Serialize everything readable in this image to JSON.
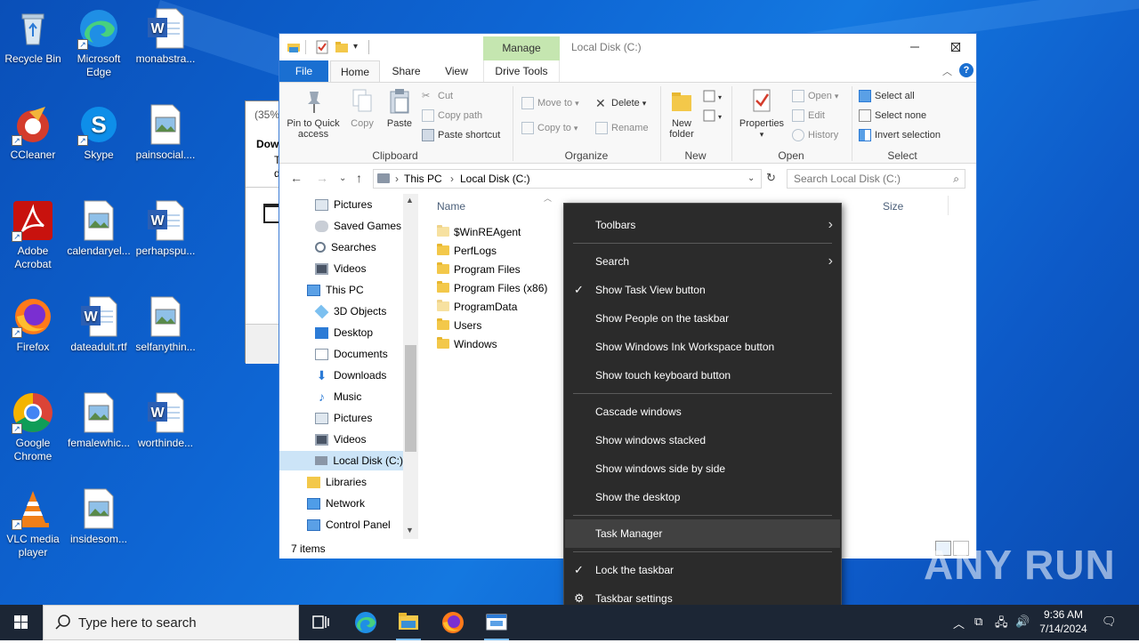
{
  "desktop": {
    "icons": [
      {
        "label": "Recycle Bin"
      },
      {
        "label": "Microsoft Edge"
      },
      {
        "label": "monabstra..."
      },
      {
        "label": "CCleaner"
      },
      {
        "label": "Skype"
      },
      {
        "label": "painsocial...."
      },
      {
        "label": "Adobe Acrobat"
      },
      {
        "label": "calendaryel..."
      },
      {
        "label": "perhapspu..."
      },
      {
        "label": "Firefox"
      },
      {
        "label": "dateadult.rtf"
      },
      {
        "label": "selfanythin..."
      },
      {
        "label": "Google Chrome"
      },
      {
        "label": "femalewhic..."
      },
      {
        "label": "worthinde..."
      },
      {
        "label": "VLC media player"
      },
      {
        "label": "insidesom..."
      }
    ],
    "watermark": "ANY RUN"
  },
  "background_window": {
    "progress_text": "(35%)",
    "title_fragment": "Dow",
    "line1": "T",
    "line2": "d"
  },
  "explorer": {
    "title": "Local Disk (C:)",
    "manage_tab": "Manage",
    "tabs": {
      "file": "File",
      "home": "Home",
      "share": "Share",
      "view": "View",
      "drive_tools": "Drive Tools"
    },
    "ribbon": {
      "clipboard": {
        "pin": "Pin to Quick access",
        "copy": "Copy",
        "paste": "Paste",
        "cut": "Cut",
        "copy_path": "Copy path",
        "paste_shortcut": "Paste shortcut",
        "label": "Clipboard"
      },
      "organize": {
        "move_to": "Move to",
        "copy_to": "Copy to",
        "delete": "Delete",
        "rename": "Rename",
        "label": "Organize"
      },
      "new": {
        "new_folder": "New folder",
        "label": "New"
      },
      "open": {
        "properties": "Properties",
        "open": "Open",
        "edit": "Edit",
        "history": "History",
        "label": "Open"
      },
      "select": {
        "select_all": "Select all",
        "select_none": "Select none",
        "invert": "Invert selection",
        "label": "Select"
      }
    },
    "address": {
      "crumbs": [
        "This PC",
        "Local Disk (C:)"
      ],
      "search_placeholder": "Search Local Disk (C:)"
    },
    "nav_items": [
      {
        "label": "Pictures"
      },
      {
        "label": "Saved Games"
      },
      {
        "label": "Searches"
      },
      {
        "label": "Videos"
      },
      {
        "label": "This PC"
      },
      {
        "label": "3D Objects"
      },
      {
        "label": "Desktop"
      },
      {
        "label": "Documents"
      },
      {
        "label": "Downloads"
      },
      {
        "label": "Music"
      },
      {
        "label": "Pictures"
      },
      {
        "label": "Videos"
      },
      {
        "label": "Local Disk (C:)"
      },
      {
        "label": "Libraries"
      },
      {
        "label": "Network"
      },
      {
        "label": "Control Panel"
      }
    ],
    "columns": {
      "name": "Name",
      "size": "Size"
    },
    "files": [
      {
        "name": "$WinREAgent"
      },
      {
        "name": "PerfLogs"
      },
      {
        "name": "Program Files"
      },
      {
        "name": "Program Files (x86)"
      },
      {
        "name": "ProgramData"
      },
      {
        "name": "Users"
      },
      {
        "name": "Windows"
      }
    ],
    "status": "7 items"
  },
  "context_menu": {
    "items": [
      {
        "label": "Toolbars"
      },
      {
        "label": "Search"
      },
      {
        "label": "Show Task View button"
      },
      {
        "label": "Show People on the taskbar"
      },
      {
        "label": "Show Windows Ink Workspace button"
      },
      {
        "label": "Show touch keyboard button"
      },
      {
        "label": "Cascade windows"
      },
      {
        "label": "Show windows stacked"
      },
      {
        "label": "Show windows side by side"
      },
      {
        "label": "Show the desktop"
      },
      {
        "label": "Task Manager"
      },
      {
        "label": "Lock the taskbar"
      },
      {
        "label": "Taskbar settings"
      }
    ]
  },
  "taskbar": {
    "search_placeholder": "Type here to search",
    "time": "9:36 AM",
    "date": "7/14/2024"
  }
}
